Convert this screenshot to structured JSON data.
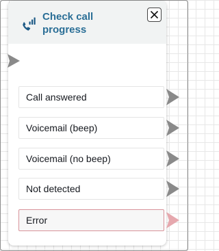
{
  "block": {
    "title": "Check call progress",
    "icon": "phone-signal-icon",
    "close_icon": "close-icon"
  },
  "branches": [
    {
      "label": "Call answered"
    },
    {
      "label": "Voicemail (beep)"
    },
    {
      "label": "Voicemail (no beep)"
    },
    {
      "label": "Not detected"
    },
    {
      "label": "Error",
      "status": "error"
    }
  ],
  "colors": {
    "title": "#2a6e96",
    "icon": "#1d5a86",
    "connector": "#8a8a8a",
    "error_connector": "#e6a8ae",
    "error_border": "#d9939a"
  }
}
